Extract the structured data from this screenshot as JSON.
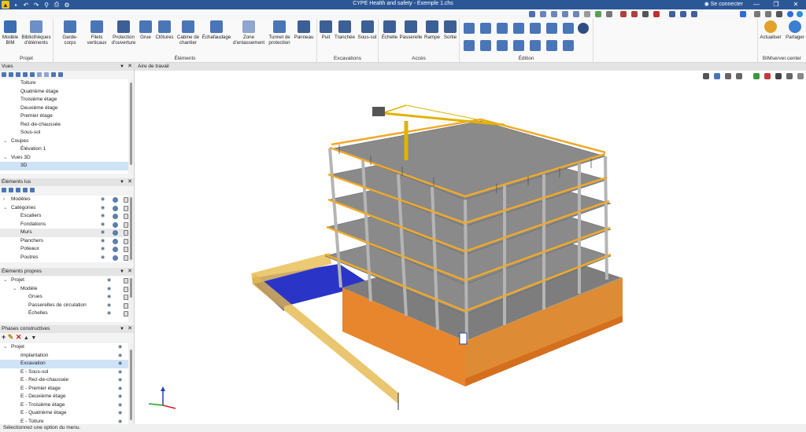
{
  "app": {
    "title": "CYPE Health and safety - Exemple 1.chs",
    "connect": "Se connecter",
    "colors": {
      "titlebar": "#2b5797",
      "selection": "#cfe3f7",
      "accent": "#1f6fd0"
    }
  },
  "ribbon": {
    "groups": {
      "projet": "Projet",
      "elements": "Éléments",
      "excavations": "Excavations",
      "acces": "Accès",
      "edition": "Édition",
      "bimserver": "BIMserver.center"
    },
    "buttons": {
      "modele_bim": "Modèle BIM",
      "bibliotheques": "Bibliothèques d'éléments",
      "garde_corps": "Garde-corps",
      "filets": "Filets verticaux",
      "protection": "Protection d'ouverture",
      "grue": "Grue",
      "clotures": "Clôtures",
      "cabine": "Cabine de chantier",
      "echafaudage": "Échafaudage",
      "zone": "Zone d'entassement",
      "tunnel": "Tunnel de protection",
      "panneau": "Panneau",
      "puit": "Puit",
      "tranchee": "Tranchée",
      "soussol": "Sous-sol",
      "echelle": "Échelle",
      "passerelle": "Passerelle",
      "rampe": "Rampe",
      "sortie": "Sortie",
      "actualiser": "Actualiser",
      "partager": "Partager"
    }
  },
  "panels": {
    "vues": {
      "title": "Vues",
      "items": [
        {
          "label": "Toiture",
          "indent": 26,
          "exp": ""
        },
        {
          "label": "Quatrième étage",
          "indent": 26,
          "exp": ""
        },
        {
          "label": "Troisième étage",
          "indent": 26,
          "exp": ""
        },
        {
          "label": "Deuxième étage",
          "indent": 26,
          "exp": ""
        },
        {
          "label": "Premier étage",
          "indent": 26,
          "exp": ""
        },
        {
          "label": "Rez-de-chaussée",
          "indent": 26,
          "exp": ""
        },
        {
          "label": "Sous-sol",
          "indent": 26,
          "exp": ""
        },
        {
          "label": "Coupes",
          "indent": 14,
          "exp": "⌄"
        },
        {
          "label": "Élévation 1",
          "indent": 26,
          "exp": ""
        },
        {
          "label": "Vues 3D",
          "indent": 14,
          "exp": "⌄"
        },
        {
          "label": "3D",
          "indent": 26,
          "exp": "",
          "sel": true
        }
      ]
    },
    "elements_lus": {
      "title": "Éléments lus",
      "items": [
        {
          "label": "Modèles",
          "indent": 14,
          "exp": "›",
          "eye": true,
          "lock": true
        },
        {
          "label": "Catégories",
          "indent": 14,
          "exp": "⌄",
          "eye": true,
          "lock": true
        },
        {
          "label": "Escaliers",
          "indent": 26,
          "eye": true,
          "lock": true
        },
        {
          "label": "Fondations",
          "indent": 26,
          "eye": true,
          "lock": true
        },
        {
          "label": "Murs",
          "indent": 26,
          "eye": true,
          "lock": true,
          "hl": true
        },
        {
          "label": "Planchers",
          "indent": 26,
          "eye": true,
          "lock": true
        },
        {
          "label": "Poteaux",
          "indent": 26,
          "eye": true,
          "lock": true
        },
        {
          "label": "Poutres",
          "indent": 26,
          "eye": true,
          "lock": true
        }
      ]
    },
    "elements_propres": {
      "title": "Éléments propres",
      "items": [
        {
          "label": "Projet",
          "indent": 14,
          "exp": "⌄"
        },
        {
          "label": "Modèle",
          "indent": 26,
          "exp": "⌄"
        },
        {
          "label": "Grues",
          "indent": 36
        },
        {
          "label": "Passerelles de circulation",
          "indent": 36
        },
        {
          "label": "Échelles",
          "indent": 36
        }
      ]
    },
    "phases": {
      "title": "Phases constructives",
      "items": [
        {
          "label": "Projet",
          "indent": 14,
          "exp": "⌄"
        },
        {
          "label": "Implantation",
          "indent": 26
        },
        {
          "label": "Excavation",
          "indent": 26,
          "sel": true
        },
        {
          "label": "E - Sous-sol",
          "indent": 26
        },
        {
          "label": "E - Rez-de-chaussée",
          "indent": 26
        },
        {
          "label": "E - Premier étage",
          "indent": 26
        },
        {
          "label": "E - Deuxième étage",
          "indent": 26
        },
        {
          "label": "E - Troisième étage",
          "indent": 26
        },
        {
          "label": "E - Quatrième étage",
          "indent": 26
        },
        {
          "label": "E - Toiture",
          "indent": 26
        }
      ]
    }
  },
  "workspace": {
    "title": "Aire de travail"
  },
  "status": "Sélectionnez une option du menu."
}
